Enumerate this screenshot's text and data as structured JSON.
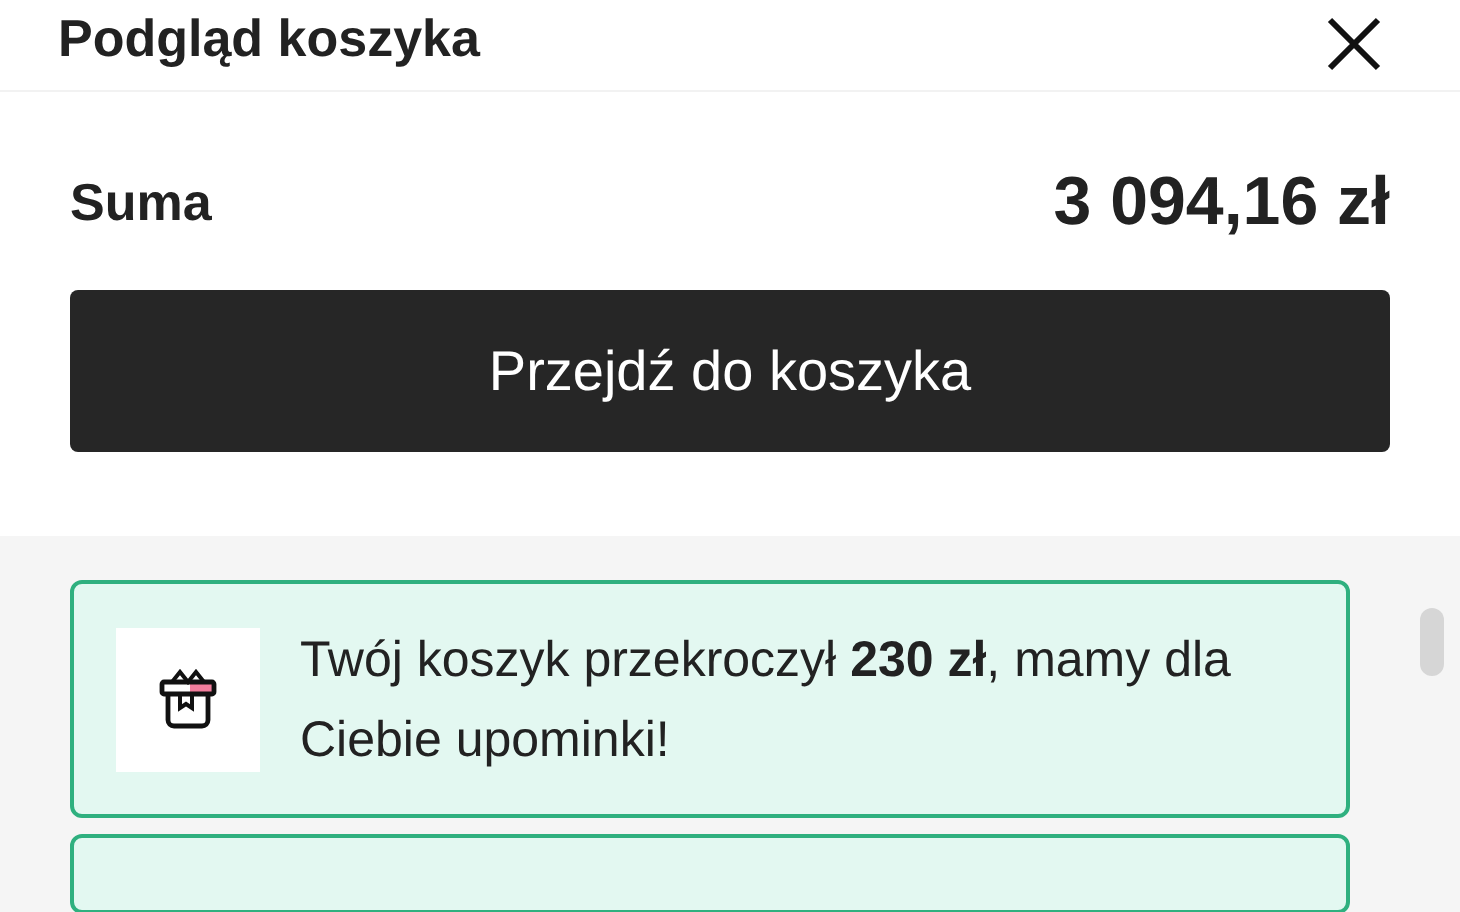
{
  "header": {
    "title": "Podgląd koszyka"
  },
  "summary": {
    "label": "Suma",
    "amount": "3 094,16 zł"
  },
  "checkout_button": {
    "label": "Przejdź do koszyka"
  },
  "notices": [
    {
      "text": "Twój koszyk przekroczył **230 zł**, mamy dla Ciebie upominki!"
    }
  ]
}
